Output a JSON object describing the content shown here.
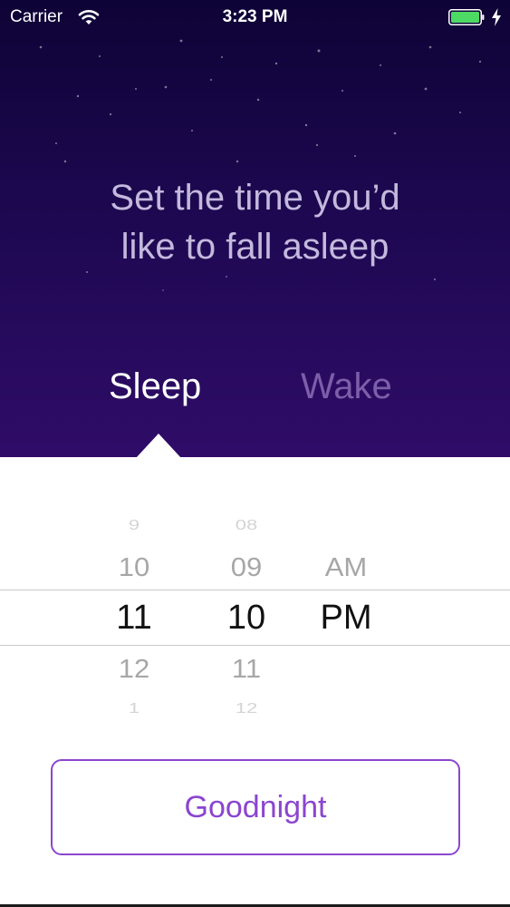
{
  "status_bar": {
    "carrier": "Carrier",
    "time": "3:23 PM",
    "battery_color": "#4cd964"
  },
  "heading": {
    "line1": "Set the time you’d",
    "line2": "like to fall asleep"
  },
  "tabs": {
    "sleep": "Sleep",
    "wake": "Wake",
    "active": "sleep"
  },
  "picker": {
    "hours": {
      "far_top": "9",
      "near_top": "10",
      "selected": "11",
      "near_bottom": "12",
      "far_bottom": "1"
    },
    "minutes": {
      "far_top": "08",
      "near_top": "09",
      "selected": "10",
      "near_bottom": "11",
      "far_bottom": "12"
    },
    "ampm": {
      "near_top": "AM",
      "selected": "PM"
    }
  },
  "button": {
    "label": "Goodnight"
  },
  "colors": {
    "accent": "#8b45cf",
    "sky_top": "#0e0336",
    "sky_bottom": "#2f0c68",
    "heading_text": "#c3b9dd",
    "inactive_tab": "#7c5ea9"
  }
}
